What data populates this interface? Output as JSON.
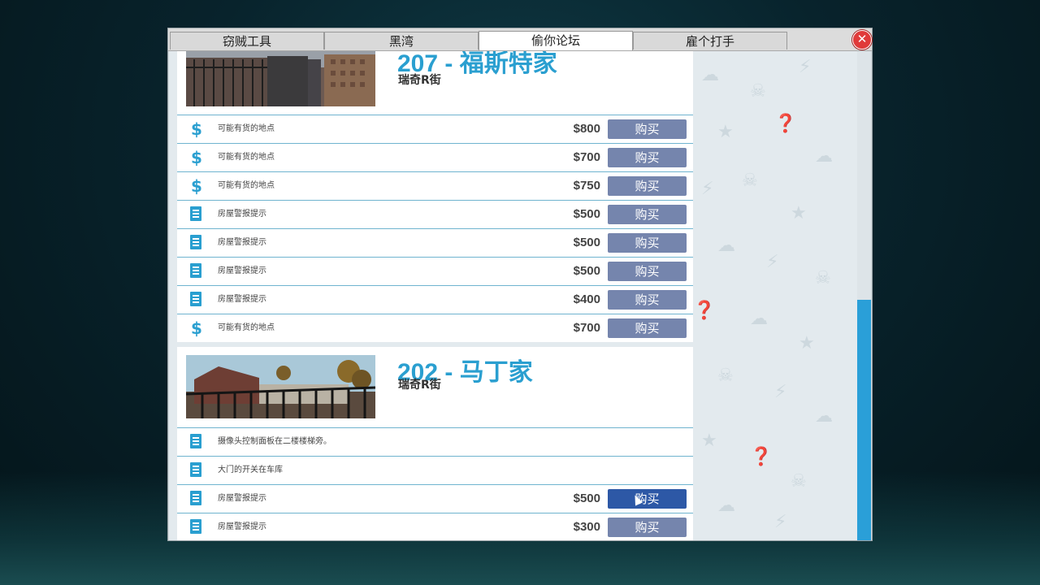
{
  "tabs": [
    {
      "label": "窃贼工具",
      "active": false
    },
    {
      "label": "黑湾",
      "active": false
    },
    {
      "label": "偷你论坛",
      "active": true
    },
    {
      "label": "雇个打手",
      "active": false
    }
  ],
  "close_icon": "close-icon",
  "colors": {
    "accent": "#2a9fd0",
    "button": "#7585ad",
    "button_hover": "#2d58a6",
    "close": "#e03a3a"
  },
  "houses": [
    {
      "title": "207 - 福斯特家",
      "street": "瑞奇R街",
      "items": [
        {
          "icon": "dollar-icon",
          "label": "可能有货的地点",
          "price": "$800",
          "button": "购买"
        },
        {
          "icon": "dollar-icon",
          "label": "可能有货的地点",
          "price": "$700",
          "button": "购买"
        },
        {
          "icon": "dollar-icon",
          "label": "可能有货的地点",
          "price": "$750",
          "button": "购买"
        },
        {
          "icon": "notepad-icon",
          "label": "房屋警报提示",
          "price": "$500",
          "button": "购买"
        },
        {
          "icon": "notepad-icon",
          "label": "房屋警报提示",
          "price": "$500",
          "button": "购买"
        },
        {
          "icon": "notepad-icon",
          "label": "房屋警报提示",
          "price": "$500",
          "button": "购买"
        },
        {
          "icon": "notepad-icon",
          "label": "房屋警报提示",
          "price": "$400",
          "button": "购买"
        },
        {
          "icon": "dollar-icon",
          "label": "可能有货的地点",
          "price": "$700",
          "button": "购买"
        }
      ]
    },
    {
      "title": "202 - 马丁家",
      "street": "瑞奇R街",
      "items": [
        {
          "icon": "notepad-icon",
          "label": "摄像头控制面板在二楼楼梯旁。"
        },
        {
          "icon": "notepad-icon",
          "label": "大门的开关在车库"
        },
        {
          "icon": "notepad-icon",
          "label": "房屋警报提示",
          "price": "$500",
          "button": "购买"
        },
        {
          "icon": "notepad-icon",
          "label": "房屋警报提示",
          "price": "$300",
          "button": "购买"
        }
      ]
    }
  ]
}
